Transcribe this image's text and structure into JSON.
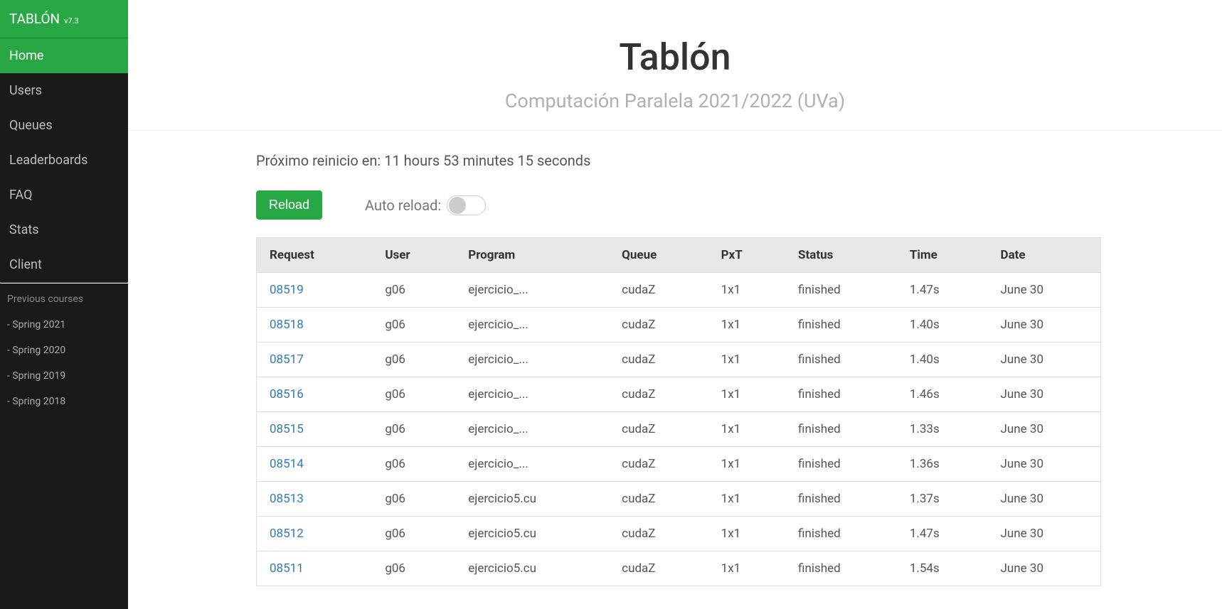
{
  "sidebar": {
    "brand_title": "TABLÓN",
    "brand_version": "v7.3",
    "nav": [
      {
        "label": "Home",
        "active": true
      },
      {
        "label": "Users",
        "active": false
      },
      {
        "label": "Queues",
        "active": false
      },
      {
        "label": "Leaderboards",
        "active": false
      },
      {
        "label": "FAQ",
        "active": false
      },
      {
        "label": "Stats",
        "active": false
      },
      {
        "label": "Client",
        "active": false
      }
    ],
    "prev_header": "Previous courses",
    "prev_links": [
      {
        "label": "- Spring 2021"
      },
      {
        "label": "- Spring 2020"
      },
      {
        "label": "- Spring 2019"
      },
      {
        "label": "- Spring 2018"
      }
    ]
  },
  "header": {
    "title": "Tablón",
    "subtitle": "Computación Paralela 2021/2022 (UVa)"
  },
  "countdown": {
    "prefix": "Próximo reinicio en: ",
    "value": "11 hours 53 minutes 15 seconds"
  },
  "controls": {
    "reload_label": "Reload",
    "auto_reload_label": "Auto reload:"
  },
  "table": {
    "headers": [
      "Request",
      "User",
      "Program",
      "Queue",
      "PxT",
      "Status",
      "Time",
      "Date"
    ],
    "rows": [
      {
        "request": "08519",
        "user": "g06",
        "program": "ejercicio_...",
        "queue": "cudaZ",
        "pxt": "1x1",
        "status": "finished",
        "time": "1.47s",
        "date": "June 30"
      },
      {
        "request": "08518",
        "user": "g06",
        "program": "ejercicio_...",
        "queue": "cudaZ",
        "pxt": "1x1",
        "status": "finished",
        "time": "1.40s",
        "date": "June 30"
      },
      {
        "request": "08517",
        "user": "g06",
        "program": "ejercicio_...",
        "queue": "cudaZ",
        "pxt": "1x1",
        "status": "finished",
        "time": "1.40s",
        "date": "June 30"
      },
      {
        "request": "08516",
        "user": "g06",
        "program": "ejercicio_...",
        "queue": "cudaZ",
        "pxt": "1x1",
        "status": "finished",
        "time": "1.46s",
        "date": "June 30"
      },
      {
        "request": "08515",
        "user": "g06",
        "program": "ejercicio_...",
        "queue": "cudaZ",
        "pxt": "1x1",
        "status": "finished",
        "time": "1.33s",
        "date": "June 30"
      },
      {
        "request": "08514",
        "user": "g06",
        "program": "ejercicio_...",
        "queue": "cudaZ",
        "pxt": "1x1",
        "status": "finished",
        "time": "1.36s",
        "date": "June 30"
      },
      {
        "request": "08513",
        "user": "g06",
        "program": "ejercicio5.cu",
        "queue": "cudaZ",
        "pxt": "1x1",
        "status": "finished",
        "time": "1.37s",
        "date": "June 30"
      },
      {
        "request": "08512",
        "user": "g06",
        "program": "ejercicio5.cu",
        "queue": "cudaZ",
        "pxt": "1x1",
        "status": "finished",
        "time": "1.47s",
        "date": "June 30"
      },
      {
        "request": "08511",
        "user": "g06",
        "program": "ejercicio5.cu",
        "queue": "cudaZ",
        "pxt": "1x1",
        "status": "finished",
        "time": "1.54s",
        "date": "June 30"
      }
    ]
  }
}
